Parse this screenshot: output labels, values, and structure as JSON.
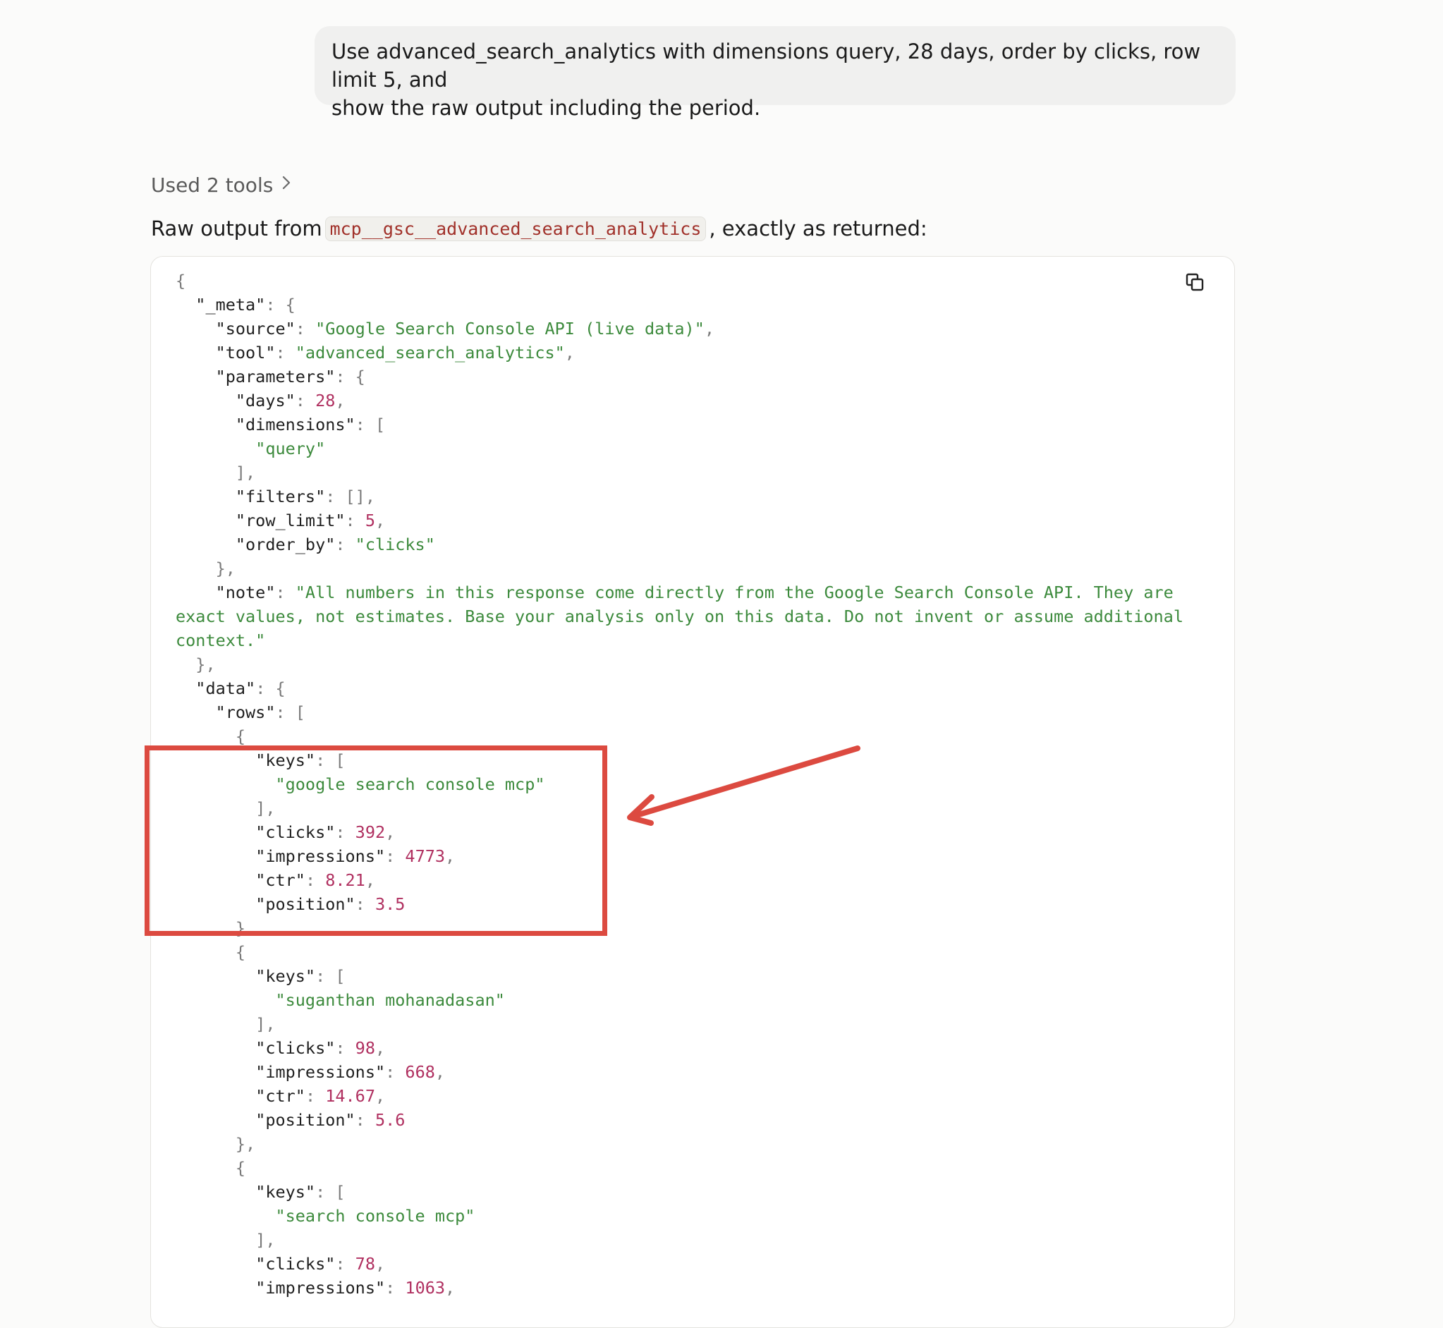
{
  "user_message": {
    "line1": "Use advanced_search_analytics with dimensions query, 28 days, order by clicks, row limit 5, and",
    "line2": "show the raw output including the period."
  },
  "tools_summary": {
    "label": "Used 2 tools",
    "chevron_icon": "chevron-right-icon"
  },
  "response": {
    "intro_prefix": "Raw output from",
    "tool_name": "mcp__gsc__advanced_search_analytics",
    "intro_suffix": ", exactly as returned:"
  },
  "code_block": {
    "copy_icon": "copy-icon",
    "meta": {
      "source": "\"Google Search Console API (live data)\"",
      "tool": "\"advanced_search_analytics\"",
      "days": "28",
      "dimension": "\"query\"",
      "filters": "[]",
      "row_limit": "5",
      "order_by": "\"clicks\"",
      "note": "\"All numbers in this response come directly from the Google Search Console API. They are exact values, not estimates. Base your analysis only on this data. Do not invent or assume additional context.\""
    },
    "rows": [
      {
        "key": "\"google search console mcp\"",
        "clicks": "392",
        "impressions": "4773",
        "ctr": "8.21",
        "position": "3.5"
      },
      {
        "key": "\"suganthan mohanadasan\"",
        "clicks": "98",
        "impressions": "668",
        "ctr": "14.67",
        "position": "5.6"
      },
      {
        "key": "\"search console mcp\"",
        "clicks": "78",
        "impressions": "1063"
      }
    ]
  },
  "colors": {
    "annotation": "#dc4a40",
    "string": "#3c8a3c",
    "number": "#b03060",
    "inline_code": "#a1312a"
  }
}
